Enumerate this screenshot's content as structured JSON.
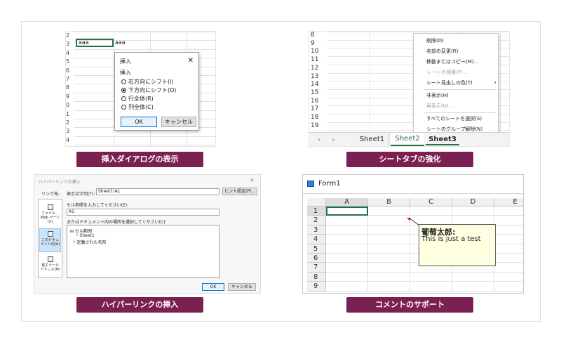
{
  "panel1": {
    "caption": "挿入ダイアログの表示",
    "row_numbers": [
      "2",
      "3",
      "4",
      "5",
      "6",
      "7",
      "8",
      "9",
      "0",
      "1",
      "2",
      "3",
      "4"
    ],
    "cell_a": "aaa",
    "cell_b": "aaa",
    "dialog": {
      "title": "挿入",
      "close": "✕",
      "group_label": "挿入",
      "options": [
        "右方向にシフト(I)",
        "下方向にシフト(D)",
        "行全体(R)",
        "列全体(C)"
      ],
      "selected_index": 1,
      "ok": "OK",
      "cancel": "キャンセル"
    }
  },
  "panel2": {
    "caption": "シートタブの強化",
    "row_numbers": [
      "8",
      "9",
      "10",
      "11",
      "12",
      "13",
      "14",
      "15",
      "16",
      "17",
      "18",
      "19"
    ],
    "menu": [
      "削除(D)",
      "名前の変更(R)",
      "移動またはコピー(M)...",
      "シートの保護(P)...",
      "シート見出しの色(T)",
      "非表示(H)",
      "再表示(U)...",
      "すべてのシートを選択(S)",
      "シートのグループ解除(N)"
    ],
    "submenu_arrow": "›",
    "tabs": [
      "Sheet1",
      "Sheet2",
      "Sheet3"
    ],
    "nav_left": "‹",
    "nav_right": "›"
  },
  "panel3": {
    "caption": "ハイパーリンクの挿入",
    "dialog_title": "ハイパーリンクの挿入",
    "close": "×",
    "link_to": "リンク先:",
    "display_text_label": "表示文字列(T):",
    "display_text_value": "Sheet1!A1",
    "tip_button": "ヒント設定(P)...",
    "cell_ref_label": "セル参照を入力してください(E):",
    "cell_ref_value": "A1",
    "place_label": "またはドキュメント内の場所を選択してください(C):",
    "tree": [
      "セル範囲",
      "Sheet1",
      "定義された名前"
    ],
    "side_items": [
      "ファイル、Web ページ(X)",
      "このドキュメント内(A)",
      "電子メール アドレス(M)"
    ],
    "ok": "OK",
    "cancel": "キャンセル"
  },
  "panel4": {
    "caption": "コメントのサポート",
    "window_title": "Form1",
    "columns": [
      "A",
      "B",
      "C",
      "D",
      "E"
    ],
    "rows": [
      "1",
      "2",
      "3",
      "4",
      "5",
      "6",
      "7",
      "8",
      "9"
    ],
    "comment_author": "葡萄太郎:",
    "comment_text": "This is just a test"
  },
  "colors": {
    "accent": "#7b2152",
    "excel_green": "#217346",
    "comment_bg": "#ffffe1"
  }
}
